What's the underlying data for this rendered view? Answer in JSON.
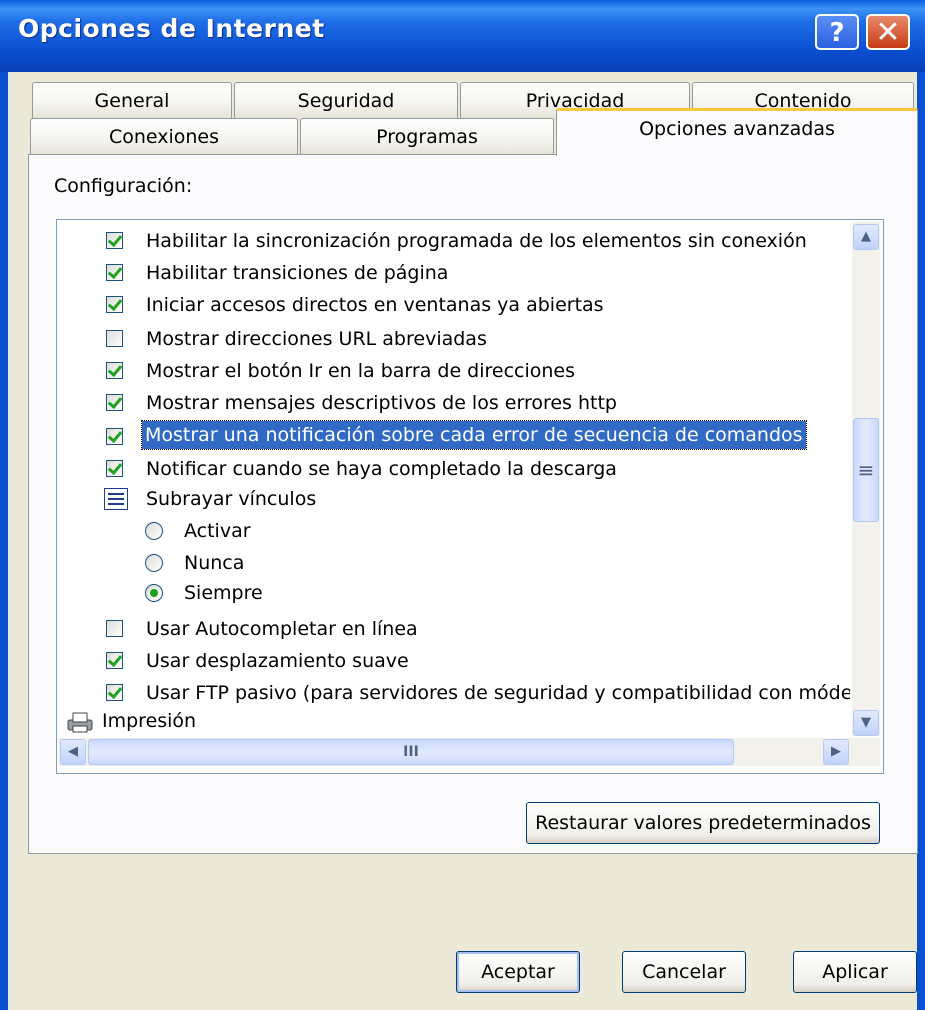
{
  "window": {
    "title": "Opciones de Internet",
    "help_label": "?",
    "close_label": "✕"
  },
  "tabs_row1": [
    "General",
    "Seguridad",
    "Privacidad",
    "Contenido"
  ],
  "tabs_row2": [
    "Conexiones",
    "Programas",
    "Opciones avanzadas"
  ],
  "active_tab": "Opciones avanzadas",
  "config_label": "Configuración:",
  "settings": [
    {
      "label": "Habilitar la sincronización programada de los elementos sin conexión",
      "checked": true
    },
    {
      "label": "Habilitar transiciones de página",
      "checked": true
    },
    {
      "label": "Iniciar accesos directos en ventanas ya abiertas",
      "checked": true
    },
    {
      "label": "Mostrar direcciones URL abreviadas",
      "checked": false
    },
    {
      "label": "Mostrar el botón Ir en la barra de direcciones",
      "checked": true
    },
    {
      "label": "Mostrar mensajes descriptivos de los errores http",
      "checked": true
    },
    {
      "label": "Mostrar una notificación sobre cada error de secuencia de comandos",
      "checked": true,
      "selected": true
    },
    {
      "label": "Notificar cuando se haya completado la descarga",
      "checked": true
    }
  ],
  "underline_group": {
    "label": "Subrayar vínculos",
    "options": [
      "Activar",
      "Nunca",
      "Siempre"
    ],
    "selected": "Siempre"
  },
  "settings2": [
    {
      "label": "Usar Autocompletar en línea",
      "checked": false
    },
    {
      "label": "Usar desplazamiento suave",
      "checked": true
    },
    {
      "label": "Usar FTP pasivo (para servidores de seguridad y compatibilidad con módem",
      "checked": true
    }
  ],
  "print_category": "Impresión",
  "scroll_grip": "≡",
  "hscroll_grip": "III",
  "restore_button": "Restaurar valores predeterminados",
  "buttons": {
    "ok": "Aceptar",
    "cancel": "Cancelar",
    "apply": "Aplicar"
  }
}
